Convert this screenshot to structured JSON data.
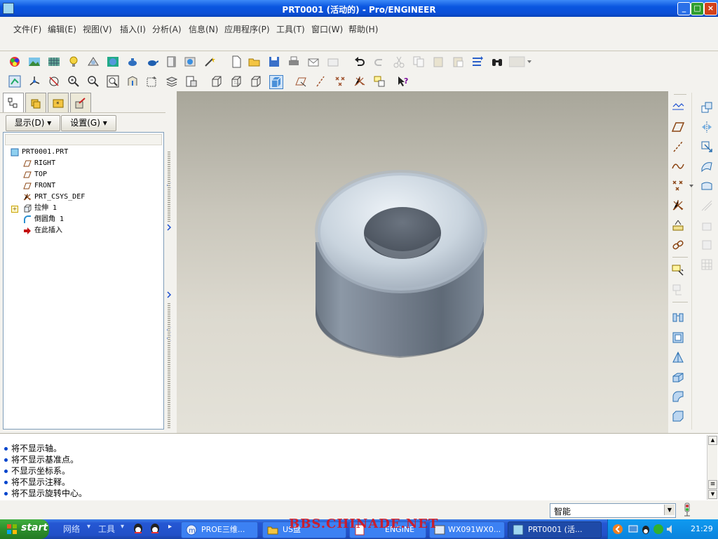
{
  "window": {
    "title": "PRT0001 (活动的) - Pro/ENGINEER",
    "controls": [
      "minimize",
      "maximize",
      "close"
    ]
  },
  "menubar": {
    "items": [
      "文件(F)",
      "编辑(E)",
      "视图(V)",
      "插入(I)",
      "分析(A)",
      "信息(N)",
      "应用程序(P)",
      "工具(T)",
      "窗口(W)",
      "帮助(H)"
    ]
  },
  "left_panel": {
    "tabs": [
      "model-tree-tab",
      "layer-tree-tab",
      "favorites-tab",
      "connection-tab"
    ],
    "show_button": "显示(D)",
    "settings_button": "设置(G)",
    "tree": [
      {
        "label": "PRT0001.PRT",
        "icon": "part-icon",
        "indent": 0
      },
      {
        "label": "RIGHT",
        "icon": "datum-plane-icon",
        "indent": 1
      },
      {
        "label": "TOP",
        "icon": "datum-plane-icon",
        "indent": 1
      },
      {
        "label": "FRONT",
        "icon": "datum-plane-icon",
        "indent": 1
      },
      {
        "label": "PRT_CSYS_DEF",
        "icon": "csys-icon",
        "indent": 1
      },
      {
        "label": "拉伸 1",
        "icon": "extrude-icon",
        "indent": 1,
        "expandable": true
      },
      {
        "label": "倒圆角 1",
        "icon": "round-icon",
        "indent": 1
      },
      {
        "label": "在此插入",
        "icon": "insert-here-arrow-icon",
        "indent": 1
      }
    ]
  },
  "messages": [
    "将不显示轴。",
    "将不显示基准点。",
    "不显示坐标系。",
    "将不显示注释。",
    "将不显示旋转中心。"
  ],
  "status": {
    "filter_value": "智能"
  },
  "taskbar": {
    "start_label": "start",
    "quick_items": [
      "网络",
      "工具"
    ],
    "tasks": [
      {
        "label": "PROE三维...",
        "active": false
      },
      {
        "label": "US盘",
        "active": false
      },
      {
        "label": "ENGINE",
        "active": false
      },
      {
        "label": "WX091WX0...",
        "active": false
      },
      {
        "label": "PRT0001 (活...",
        "active": true
      }
    ],
    "clock": "21:29"
  },
  "watermark": "BBS.CHINADE.NET",
  "colors": {
    "title_bar": "#0a56e0",
    "taskbar": "#2150c8",
    "start_button": "#2d8f2d",
    "model_surface": "#8e9aa8"
  }
}
